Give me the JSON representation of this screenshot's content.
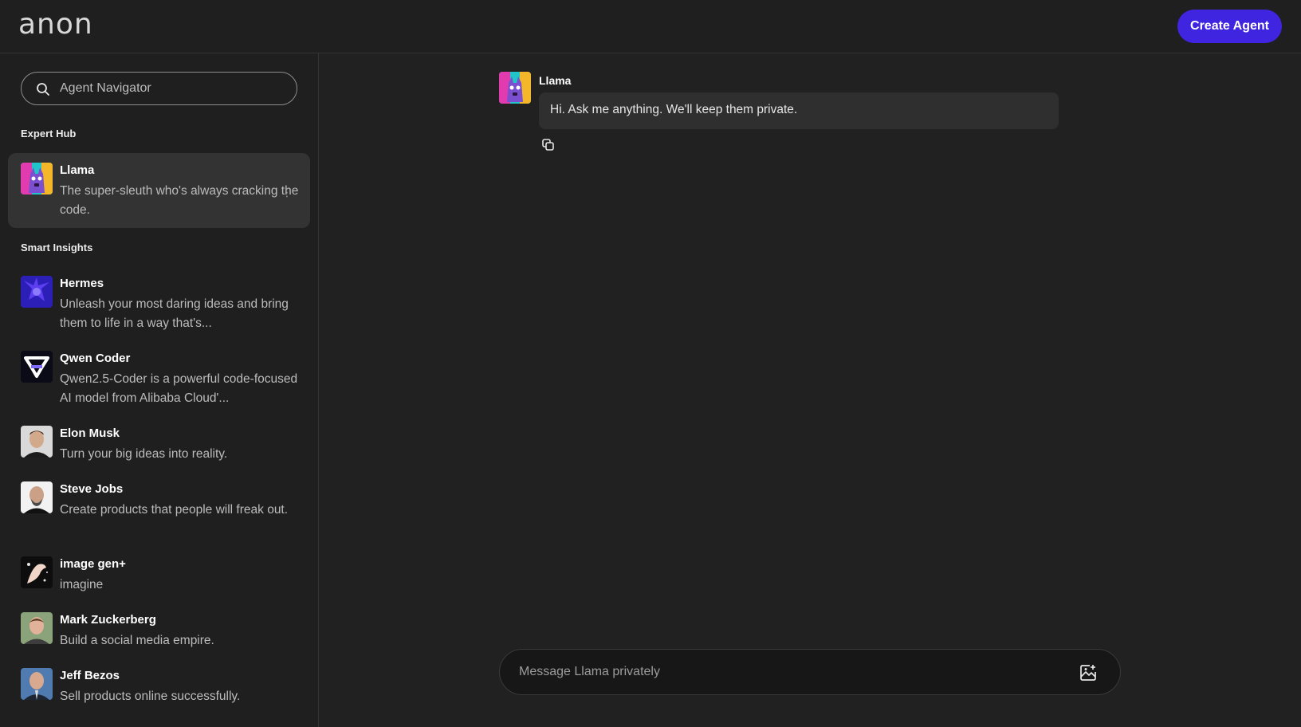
{
  "header": {
    "logo": "anon",
    "create_agent_label": "Create Agent"
  },
  "sidebar": {
    "search_placeholder": "Agent Navigator",
    "sections": [
      {
        "title": "Expert Hub",
        "agents": [
          {
            "name": "Llama",
            "description": "The super-sleuth who's always cracking the code.",
            "avatar": "llama-avatar",
            "active": true
          }
        ]
      },
      {
        "title": "Smart Insights",
        "agents": [
          {
            "name": "Hermes",
            "description": "Unleash your most daring ideas and bring them to life in a way that's...",
            "avatar": "hermes-avatar"
          },
          {
            "name": "Qwen Coder",
            "description": "Qwen2.5-Coder is a powerful code-focused AI model from Alibaba Cloud'...",
            "avatar": "qwen-logo"
          },
          {
            "name": "Elon Musk",
            "description": "Turn your big ideas into reality.",
            "avatar": "elon-musk-photo"
          },
          {
            "name": "Steve Jobs",
            "description": "Create products that people will freak out.",
            "avatar": "steve-jobs-photo"
          },
          {
            "name": "image gen+",
            "description": "imagine",
            "avatar": "image-gen-avatar"
          },
          {
            "name": "Mark Zuckerberg",
            "description": "Build a social media empire.",
            "avatar": "mark-zuckerberg-photo"
          },
          {
            "name": "Jeff Bezos",
            "description": "Sell products online successfully.",
            "avatar": "jeff-bezos-photo"
          }
        ]
      }
    ]
  },
  "chat": {
    "agent_name": "Llama",
    "messages": [
      {
        "sender": "Llama",
        "text": "Hi. Ask me anything. We'll keep them private."
      }
    ],
    "composer_placeholder": "Message Llama privately"
  },
  "colors": {
    "accent": "#3f25e0",
    "background": "#212121",
    "sidebar": "#1f1f1f",
    "active_item": "#333333",
    "bubble": "#2f2f2f"
  }
}
